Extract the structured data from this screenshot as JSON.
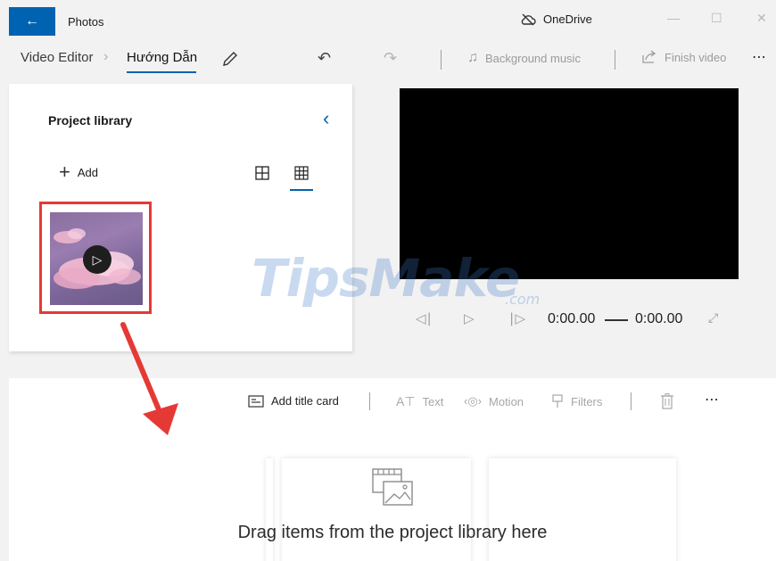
{
  "app": {
    "title": "Photos",
    "onedrive_label": "OneDrive"
  },
  "toolbar": {
    "breadcrumb_root": "Video Editor",
    "breadcrumb_current": "Hướng Dẫn",
    "background_music": "Background music",
    "finish_video": "Finish video"
  },
  "library": {
    "title": "Project library",
    "add_label": "Add"
  },
  "player": {
    "current_time": "0:00.00",
    "total_time": "0:00.00"
  },
  "watermark": {
    "main": "TipsMake",
    "suffix": ".com"
  },
  "storyboard": {
    "add_title_card": "Add title card",
    "text": "Text",
    "motion": "Motion",
    "filters": "Filters",
    "drag_hint": "Drag items from the project library here"
  },
  "colors": {
    "accent": "#0063b1",
    "highlight": "#e53935"
  }
}
